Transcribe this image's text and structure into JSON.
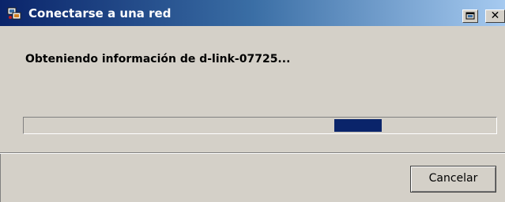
{
  "window": {
    "title": "Conectarse a una red"
  },
  "main": {
    "status_text": "Obteniendo información de d-link-07725...",
    "progress_kind": "indeterminate-marquee"
  },
  "footer": {
    "cancel_label": "Cancelar"
  },
  "icons": {
    "app": "network-connect-icon",
    "restore": "restore-window-icon",
    "close": "close-icon"
  },
  "colors": {
    "titlebar_start": "#0a246a",
    "titlebar_end": "#a6caf0",
    "progress_fill": "#0a246a",
    "face": "#d4d0c8"
  }
}
